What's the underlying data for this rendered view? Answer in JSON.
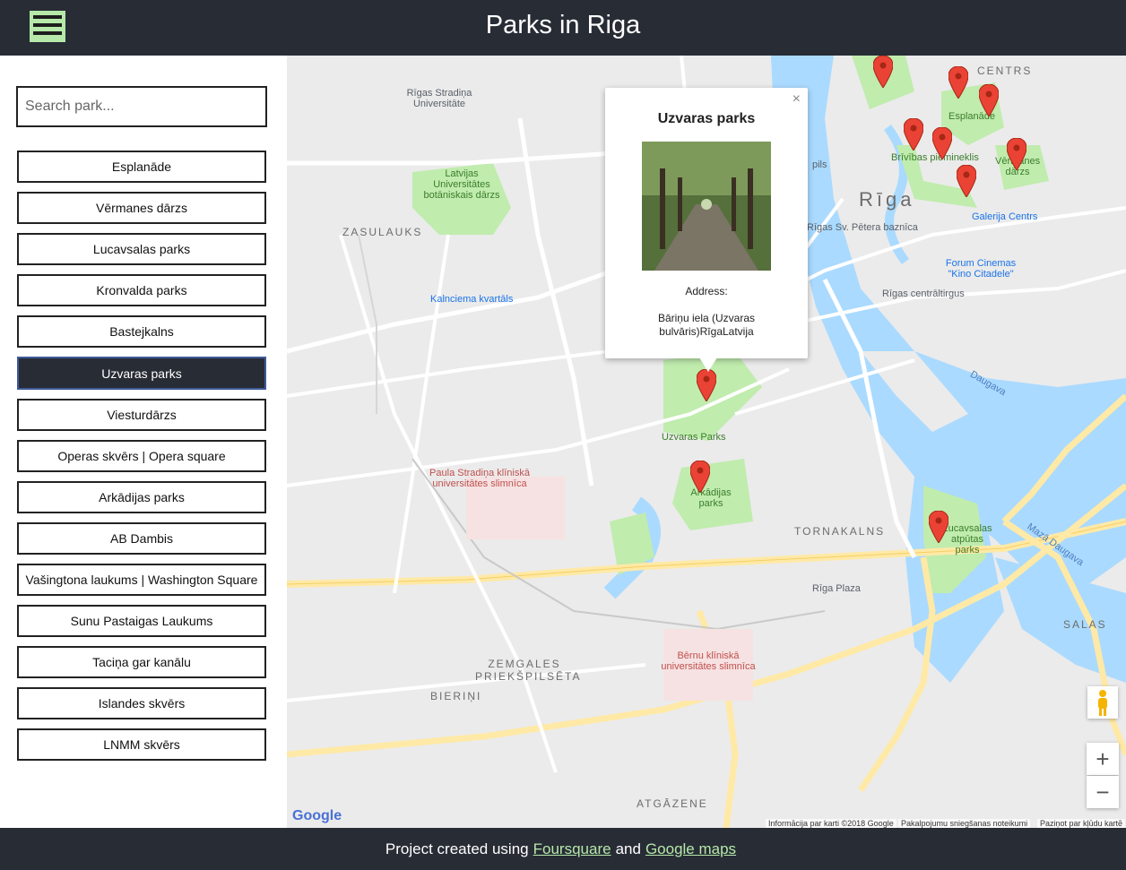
{
  "header": {
    "title": "Parks in Riga",
    "menu_icon": "hamburger-icon"
  },
  "search": {
    "placeholder": "Search park..."
  },
  "parks": [
    "Esplanāde",
    "Vērmanes dārzs",
    "Lucavsalas parks",
    "Kronvalda parks",
    "Bastejkalns",
    "Uzvaras parks",
    "Viesturdārzs",
    "Operas skvērs | Opera square",
    "Arkādijas parks",
    "AB Dambis",
    "Vašingtona laukums | Washington Square",
    "Sunu Pastaigas Laukums",
    "Taciņa gar kanālu",
    "Islandes skvērs",
    "LNMM skvērs"
  ],
  "selected_park": "Uzvaras parks",
  "infowindow": {
    "title": "Uzvaras parks",
    "address_label": "Address:",
    "address": "Bāriņu iela (Uzvaras bulvāris)RīgaLatvija",
    "close": "×"
  },
  "map": {
    "labels": {
      "stradina_uni": "Rīgas Stradiņa Universitāte",
      "botanic": "Latvijas Universitātes botāniskais dārzs",
      "zasulauks": "ZASULAUKS",
      "kalnciema": "Kalnciema kvartāls",
      "uzvaras": "Uzvaras Parks",
      "arkadijas": "Arkādijas parks",
      "stradina_hosp": "Paula Stradiņa klīniskā universitātes slimnīca",
      "tornakalns": "TORNAKALNS",
      "zemgales": "ZEMGALES PRIEKŠPILSĒTA",
      "bierini": "BIERIŅI",
      "berni": "Bērnu klīniskā universitātes slimnīca",
      "atgazene": "ATGĀZENE",
      "riga": "Rīga",
      "centrs": "CENTRS",
      "esplanade": "Esplanāde",
      "brivibas": "Brīvības piemineklis",
      "vermanes": "Vērmanes dārzs",
      "galerija": "Galerija Centrs",
      "forum": "Forum Cinemas \"Kino Citadele\"",
      "centraltirgus": "Rīgas centrāltirgus",
      "lucavsalas": "Lucavsalas atpūtas parks",
      "riga_plaza": "Rīga Plaza",
      "salas": "SALAS",
      "daugava": "Daugava",
      "maza_daugava": "Mazā Daugava",
      "petera": "Rīgas Sv. Pētera baznīca",
      "pils": "pils"
    },
    "zoom_in": "+",
    "zoom_out": "−",
    "google": "Google",
    "footer_data": "Informācija par karti ©2018 Google",
    "footer_terms": "Pakalpojumu sniegšanas noteikumi",
    "footer_report": "Paziņot par kļūdu kartē"
  },
  "footer": {
    "prefix": "Project created using",
    "link1": "Foursquare",
    "middle": "and",
    "link2": "Google maps"
  },
  "colors": {
    "header_bg": "#282c35",
    "accent": "#b5e8a9",
    "pin": "#ea4335",
    "water": "#aadaff",
    "park": "#c0ecae"
  }
}
